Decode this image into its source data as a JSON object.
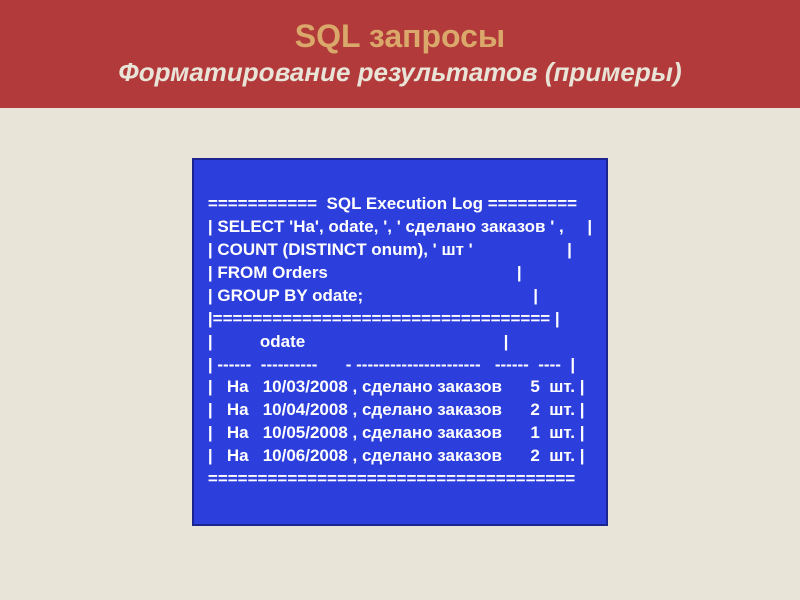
{
  "header": {
    "title": "SQL запросы",
    "subtitle": "Форматирование результатов (примеры)"
  },
  "sql": {
    "lines": [
      "===========  SQL Execution Log =========",
      "| SELECT 'На', odate, ', ' сделано заказов ' ,     |",
      "| COUNT (DISTINCT onum), ' шт '                    |",
      "| FROM Orders                                        |",
      "| GROUP BY odate;                                    |",
      "|================================== |",
      "|          odate                                          |",
      "| ------  ----------      - ----------------------   ------  ----  |",
      "|   На   10/03/2008 , сделано заказов      5  шт. |",
      "|   На   10/04/2008 , сделано заказов      2  шт. |",
      "|   На   10/05/2008 , сделано заказов      1  шт. |",
      "|   На   10/06/2008 , сделано заказов      2  шт. |",
      "====================================="
    ]
  }
}
